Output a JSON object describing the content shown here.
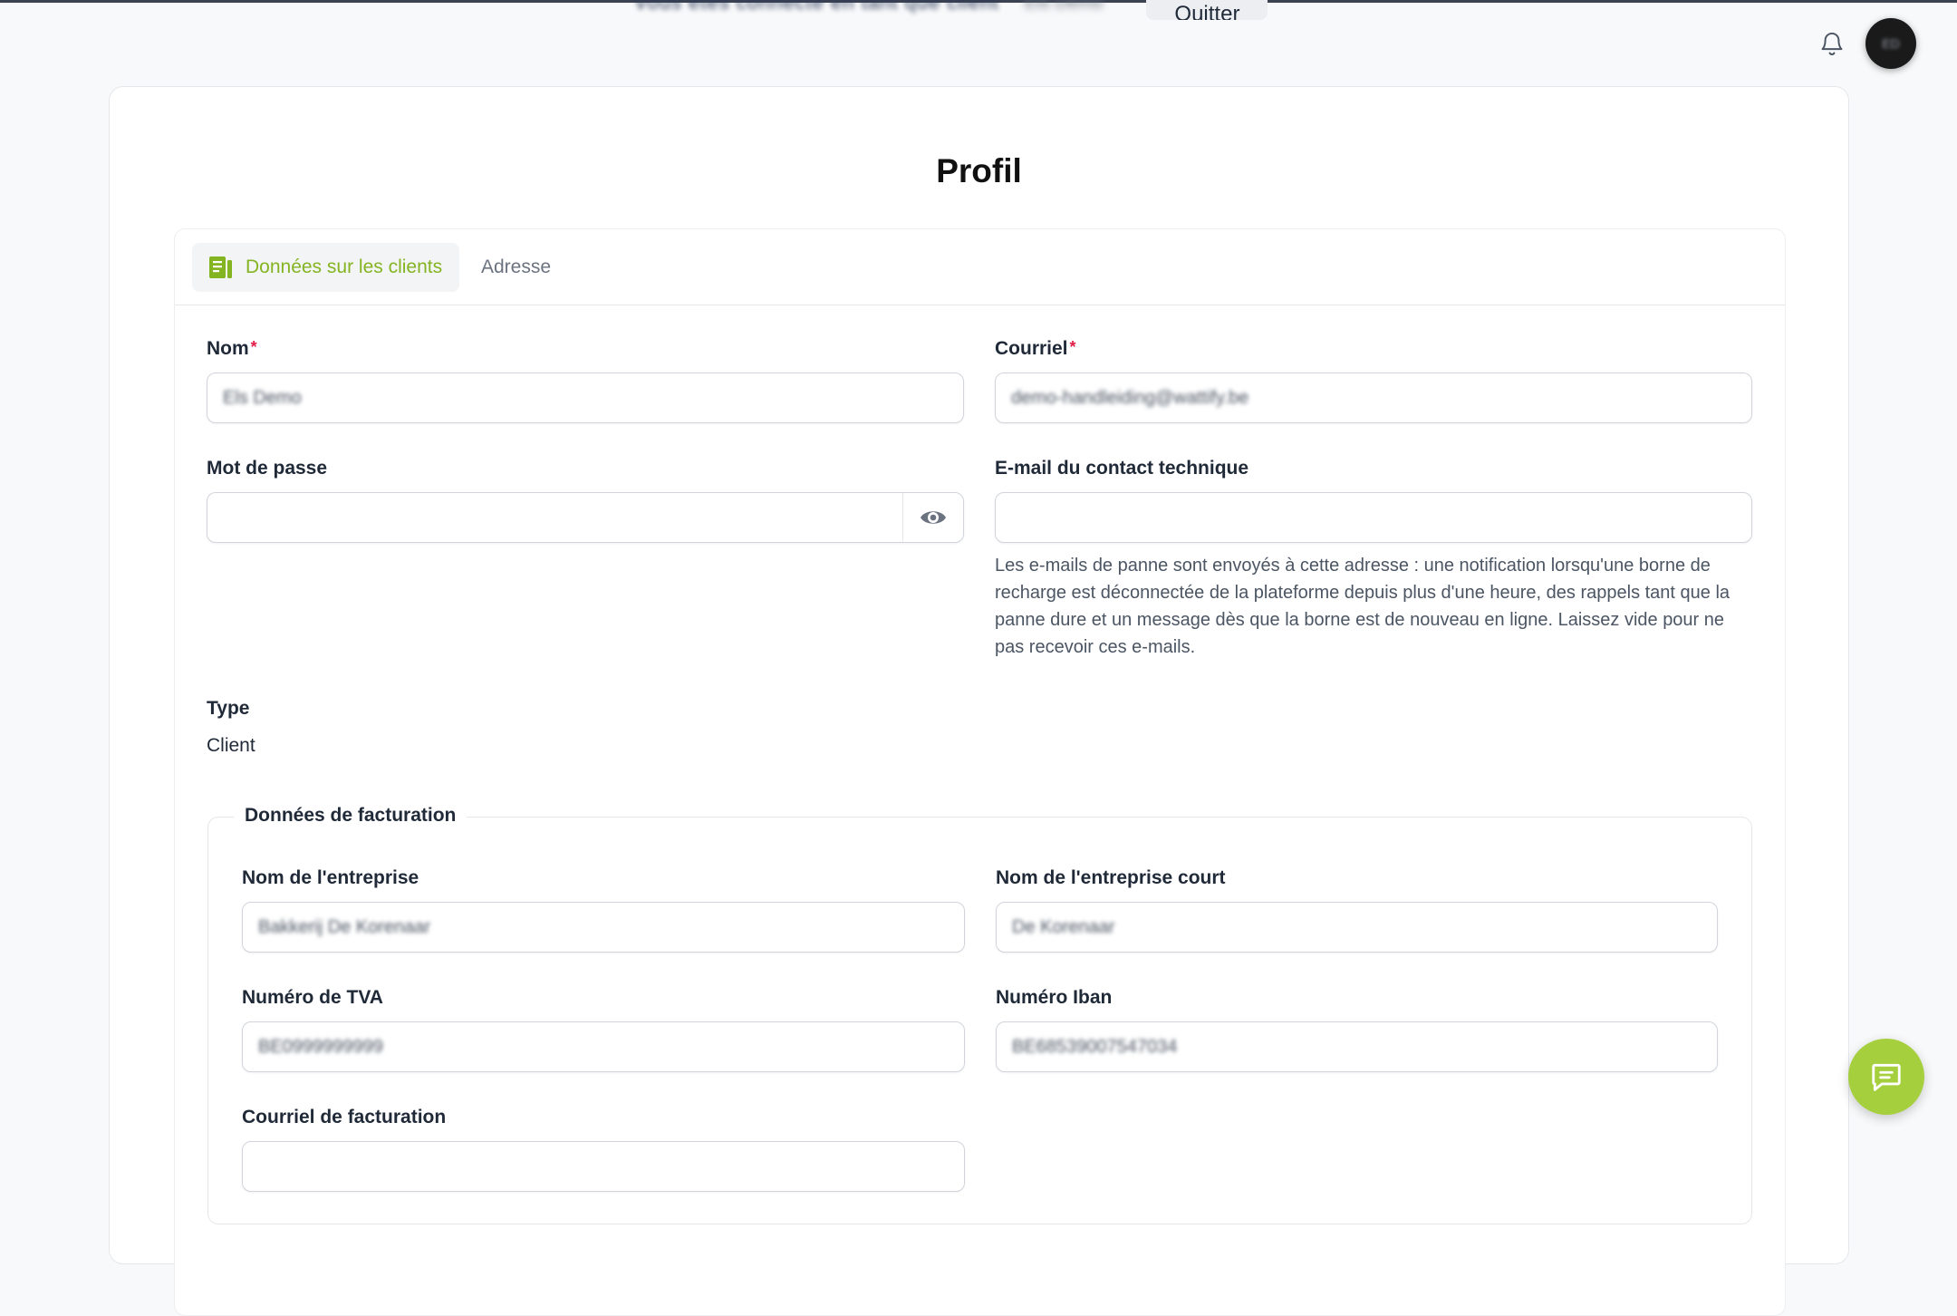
{
  "topbar": {
    "impersonation_text": "Vous êtes connecté en tant que client",
    "impersonation_name": "Els Demo",
    "quit_label": "Quitter",
    "avatar_initials": "ED"
  },
  "page": {
    "title": "Profil"
  },
  "tabs": [
    {
      "label": "Données sur les clients",
      "icon": "document-icon",
      "active": true
    },
    {
      "label": "Adresse",
      "active": false
    }
  ],
  "form": {
    "name": {
      "label": "Nom",
      "value": "Els Demo",
      "required": "*"
    },
    "email": {
      "label": "Courriel",
      "value": "demo-handleiding@wattify.be",
      "required": "*"
    },
    "password": {
      "label": "Mot de passe",
      "value": ""
    },
    "tech_email": {
      "label": "E-mail du contact technique",
      "value": "",
      "help": "Les e-mails de panne sont envoyés à cette adresse : une notification lorsqu'une borne de recharge est déconnectée de la plateforme depuis plus d'une heure, des rappels tant que la panne dure et un message dès que la borne est de nouveau en ligne. Laissez vide pour ne pas recevoir ces e-mails."
    },
    "type": {
      "label": "Type",
      "value": "Client"
    }
  },
  "billing": {
    "legend": "Données de facturation",
    "company_name": {
      "label": "Nom de l'entreprise",
      "value": "Bakkerij De Korenaar"
    },
    "company_short": {
      "label": "Nom de l'entreprise court",
      "value": "De Korenaar"
    },
    "vat": {
      "label": "Numéro de TVA",
      "value": "BE0999999999"
    },
    "iban": {
      "label": "Numéro Iban",
      "value": "BE68539007547034"
    },
    "billing_email": {
      "label": "Courriel de facturation",
      "value": ""
    }
  },
  "colors": {
    "accent": "#84b422",
    "fab": "#a6cf3e"
  }
}
